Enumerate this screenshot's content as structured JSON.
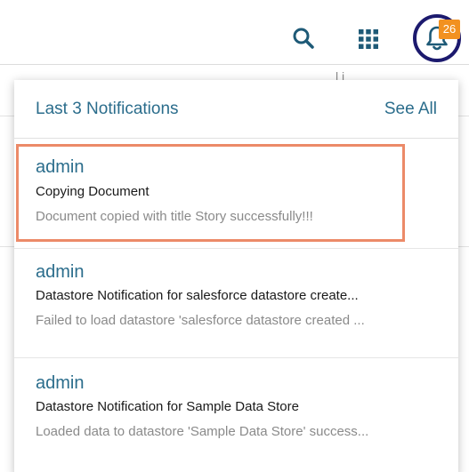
{
  "topbar": {
    "notification_count": "26",
    "icons": {
      "search": "search-icon",
      "apps": "apps-grid-icon",
      "notifications": "bell-icon"
    },
    "colors": {
      "icon": "#1e5a77",
      "bell_ring": "#1c1a6e",
      "badge": "#f29120"
    }
  },
  "background": {
    "partial_text": "l   i"
  },
  "panel": {
    "title": "Last 3 Notifications",
    "see_all_label": "See All",
    "notifications": [
      {
        "user": "admin",
        "title": "Copying Document",
        "message": "Document copied with title Story successfully!!!",
        "highlighted": true
      },
      {
        "user": "admin",
        "title": "Datastore Notification for salesforce datastore create...",
        "message": "Failed to load datastore 'salesforce datastore created ...",
        "highlighted": false
      },
      {
        "user": "admin",
        "title": "Datastore Notification for Sample Data Store",
        "message": "Loaded data to datastore 'Sample Data Store' success...",
        "highlighted": false
      }
    ],
    "colors": {
      "link_text": "#2b6d8c",
      "highlight_border": "#ec8a68"
    }
  }
}
